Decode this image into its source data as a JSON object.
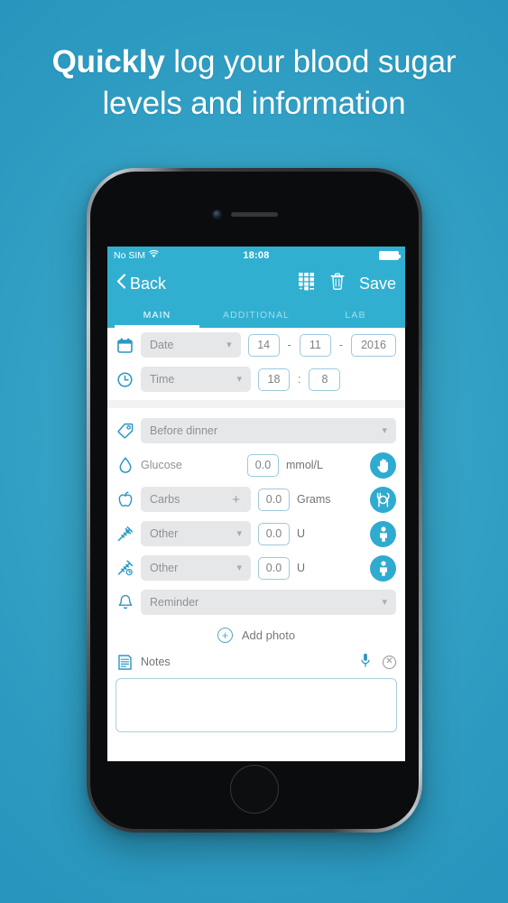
{
  "headline": {
    "bold": "Quickly",
    "rest": " log your blood sugar",
    "line2": "levels and information"
  },
  "colors": {
    "background": "#2fa0c5",
    "accent": "#31afd1",
    "icon": "#2b97c4",
    "circle_button": "#2fabd0",
    "pill": "#e6e7e9",
    "input_border": "#9dc9dc"
  },
  "status_bar": {
    "carrier": "No SIM",
    "wifi_icon": "wifi-icon",
    "time": "18:08",
    "battery_icon": "battery-full-icon"
  },
  "nav_bar": {
    "back_label": "Back",
    "back_icon": "chevron-left-icon",
    "calculator_icon": "calculator-icon",
    "trash_icon": "trash-icon",
    "save_label": "Save"
  },
  "tabs": [
    {
      "label": "MAIN",
      "active": true
    },
    {
      "label": "ADDITIONAL",
      "active": false
    },
    {
      "label": "LAB",
      "active": false
    }
  ],
  "form": {
    "date_row": {
      "icon": "calendar-icon",
      "select_label": "Date",
      "day": "14",
      "sep1": "-",
      "month": "11",
      "sep2": "-",
      "year": "2016"
    },
    "time_row": {
      "icon": "clock-icon",
      "select_label": "Time",
      "hour": "18",
      "sep": ":",
      "minute": "8"
    },
    "tag_row": {
      "icon": "tag-icon",
      "select_label": "Before dinner"
    },
    "glucose_row": {
      "icon": "droplet-icon",
      "label": "Glucose",
      "value": "0.0",
      "unit": "mmol/L",
      "action_icon": "hand-icon"
    },
    "carbs_row": {
      "icon": "apple-icon",
      "select_label": "Carbs",
      "plus": "+",
      "value": "0.0",
      "unit": "Grams",
      "action_icon": "meal-plate-icon"
    },
    "insulin1_row": {
      "icon": "syringe-icon",
      "select_label": "Other",
      "value": "0.0",
      "unit": "U",
      "action_icon": "person-icon"
    },
    "insulin2_row": {
      "icon": "syringe-clock-icon",
      "select_label": "Other",
      "value": "0.0",
      "unit": "U",
      "action_icon": "person-icon"
    },
    "reminder_row": {
      "icon": "bell-icon",
      "select_label": "Reminder"
    },
    "add_photo": {
      "icon": "plus-circle-icon",
      "label": "Add photo"
    },
    "notes": {
      "icon": "notes-document-icon",
      "label": "Notes",
      "mic_icon": "microphone-icon",
      "clear_icon": "clear-circle-icon",
      "value": "",
      "placeholder": ""
    }
  }
}
